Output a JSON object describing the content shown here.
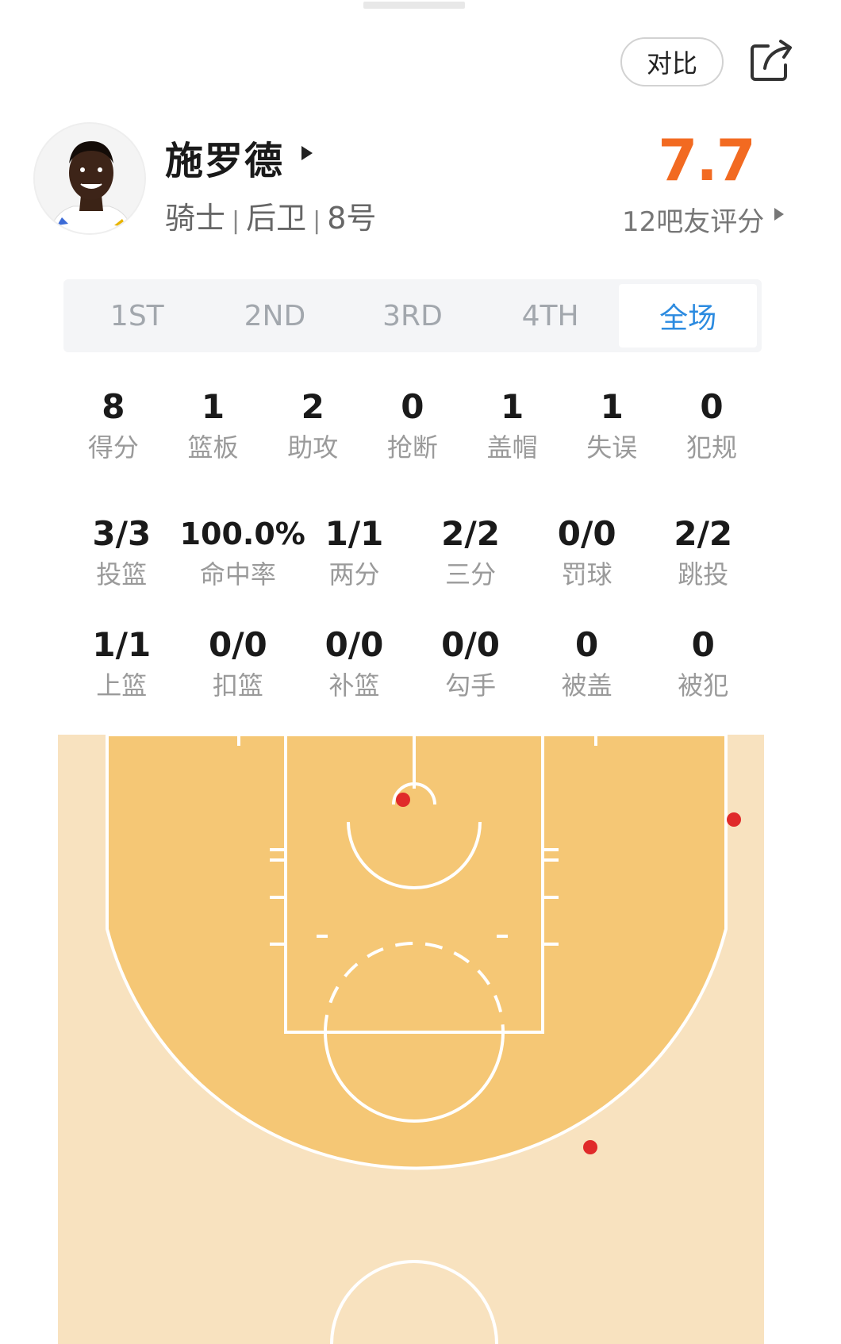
{
  "header": {
    "compare_label": "对比"
  },
  "player": {
    "name": "施罗德",
    "team": "骑士",
    "position": "后卫",
    "number": "8号",
    "rating": "7.7",
    "rating_label": "12吧友评分"
  },
  "quarter_tabs": [
    {
      "label": "1ST",
      "active": false
    },
    {
      "label": "2ND",
      "active": false
    },
    {
      "label": "3RD",
      "active": false
    },
    {
      "label": "4TH",
      "active": false
    },
    {
      "label": "全场",
      "active": true
    }
  ],
  "stats_main": [
    {
      "value": "8",
      "label": "得分"
    },
    {
      "value": "1",
      "label": "篮板"
    },
    {
      "value": "2",
      "label": "助攻"
    },
    {
      "value": "0",
      "label": "抢断"
    },
    {
      "value": "1",
      "label": "盖帽"
    },
    {
      "value": "1",
      "label": "失误"
    },
    {
      "value": "0",
      "label": "犯规"
    }
  ],
  "stats_shooting": [
    {
      "value": "3/3",
      "label": "投篮"
    },
    {
      "value": "100.0%",
      "label": "命中率"
    },
    {
      "value": "1/1",
      "label": "两分"
    },
    {
      "value": "2/2",
      "label": "三分"
    },
    {
      "value": "0/0",
      "label": "罚球"
    },
    {
      "value": "2/2",
      "label": "跳投"
    }
  ],
  "stats_shot_types": [
    {
      "value": "1/1",
      "label": "上篮"
    },
    {
      "value": "0/0",
      "label": "扣篮"
    },
    {
      "value": "0/0",
      "label": "补篮"
    },
    {
      "value": "0/0",
      "label": "勾手"
    },
    {
      "value": "0",
      "label": "被盖"
    },
    {
      "value": "0",
      "label": "被犯"
    }
  ],
  "colors": {
    "accent": "#2c8be0",
    "rating": "#f26a21",
    "court_outer": "#f8e2bf",
    "court_inner": "#f5c775",
    "shot_made": "#e02a2a"
  }
}
